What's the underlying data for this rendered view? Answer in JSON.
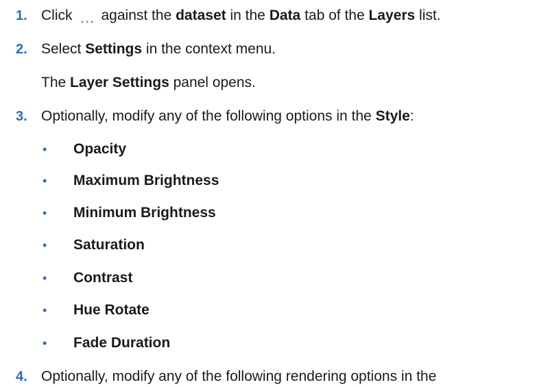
{
  "steps": [
    {
      "num": "1.",
      "t1": "Click",
      "t2": "against the",
      "b1": "dataset",
      "t3": "in the",
      "b2": "Data",
      "t4": "tab of the",
      "b3": "Layers",
      "t5": "list.",
      "icon": "more-options-icon"
    },
    {
      "num": "2.",
      "t1": "Select",
      "b1": "Settings",
      "t2": "in the context menu.",
      "note_b": "Layer Settings",
      "note_t1": "The",
      "note_t2": "panel opens."
    },
    {
      "num": "3.",
      "t1": "Optionally, modify any of the following options in the",
      "b1": "Style",
      "t2": ":"
    },
    {
      "num": "4.",
      "t1": "Optionally, modify any of the following rendering options in the"
    }
  ],
  "bullets": [
    "Opacity",
    "Maximum Brightness",
    "Minimum Brightness",
    "Saturation",
    "Contrast",
    "Hue Rotate",
    "Fade Duration"
  ],
  "bullet_glyph": "•",
  "colors": {
    "accent": "#2b6cb0",
    "text": "#1a1a1a",
    "icon": "#9a9a9a"
  }
}
